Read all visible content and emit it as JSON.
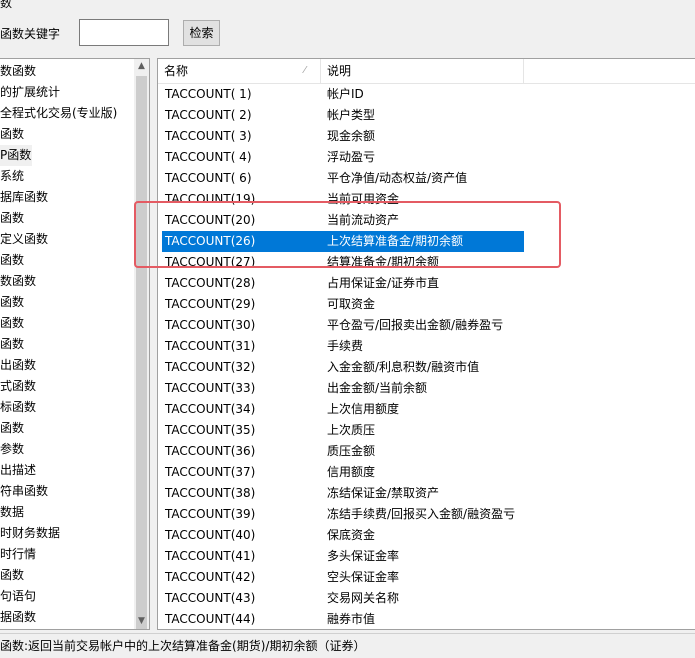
{
  "window": {
    "title_fragment": "数"
  },
  "search": {
    "label": "函数关键字",
    "value": "",
    "button_label": "检索"
  },
  "tree": {
    "items": [
      "数函数",
      "的扩展统计",
      "全程式化交易(专业版)",
      "函数",
      "P函数",
      "系统",
      "据库函数",
      "函数",
      "定义函数",
      "函数",
      "数函数",
      "函数",
      "函数",
      "函数",
      "出函数",
      "式函数",
      "标函数",
      "函数",
      "参数",
      "出描述",
      "符串函数",
      "数据",
      "时财务数据",
      "时行情",
      "函数",
      "句语句",
      "据函数"
    ],
    "selected_index": 4
  },
  "list": {
    "columns": {
      "name": "名称",
      "desc": "说明"
    },
    "rows": [
      {
        "name": "TACCOUNT( 1)",
        "desc": "帐户ID"
      },
      {
        "name": "TACCOUNT( 2)",
        "desc": "帐户类型"
      },
      {
        "name": "TACCOUNT( 3)",
        "desc": "现金余额"
      },
      {
        "name": "TACCOUNT( 4)",
        "desc": "浮动盈亏"
      },
      {
        "name": "TACCOUNT( 6)",
        "desc": "平仓净值/动态权益/资产值"
      },
      {
        "name": "TACCOUNT(19)",
        "desc": "当前可用资金"
      },
      {
        "name": "TACCOUNT(20)",
        "desc": "当前流动资产"
      },
      {
        "name": "TACCOUNT(26)",
        "desc": "上次结算准备金/期初余额"
      },
      {
        "name": "TACCOUNT(27)",
        "desc": "结算准备金/期初余额"
      },
      {
        "name": "TACCOUNT(28)",
        "desc": "占用保证金/证券市直"
      },
      {
        "name": "TACCOUNT(29)",
        "desc": "可取资金"
      },
      {
        "name": "TACCOUNT(30)",
        "desc": "平仓盈亏/回报卖出金额/融券盈亏"
      },
      {
        "name": "TACCOUNT(31)",
        "desc": "手续费"
      },
      {
        "name": "TACCOUNT(32)",
        "desc": "入金金额/利息积数/融资市值"
      },
      {
        "name": "TACCOUNT(33)",
        "desc": "出金金额/当前余额"
      },
      {
        "name": "TACCOUNT(34)",
        "desc": "上次信用额度"
      },
      {
        "name": "TACCOUNT(35)",
        "desc": "上次质压"
      },
      {
        "name": "TACCOUNT(36)",
        "desc": "质压金额"
      },
      {
        "name": "TACCOUNT(37)",
        "desc": "信用额度"
      },
      {
        "name": "TACCOUNT(38)",
        "desc": "冻结保证金/禁取资产"
      },
      {
        "name": "TACCOUNT(39)",
        "desc": "冻结手续费/回报买入金额/融资盈亏"
      },
      {
        "name": "TACCOUNT(40)",
        "desc": "保底资金"
      },
      {
        "name": "TACCOUNT(41)",
        "desc": "多头保证金率"
      },
      {
        "name": "TACCOUNT(42)",
        "desc": "空头保证金率"
      },
      {
        "name": "TACCOUNT(43)",
        "desc": "交易网关名称"
      },
      {
        "name": "TACCOUNT(44)",
        "desc": "融券市值"
      }
    ],
    "selected_index": 7
  },
  "status": {
    "text": "函数:返回当前交易帐户中的上次结算准备金(期货)/期初余额（证券）"
  },
  "colors": {
    "selection": "#0078d7",
    "highlight_box": "#e45b63"
  }
}
